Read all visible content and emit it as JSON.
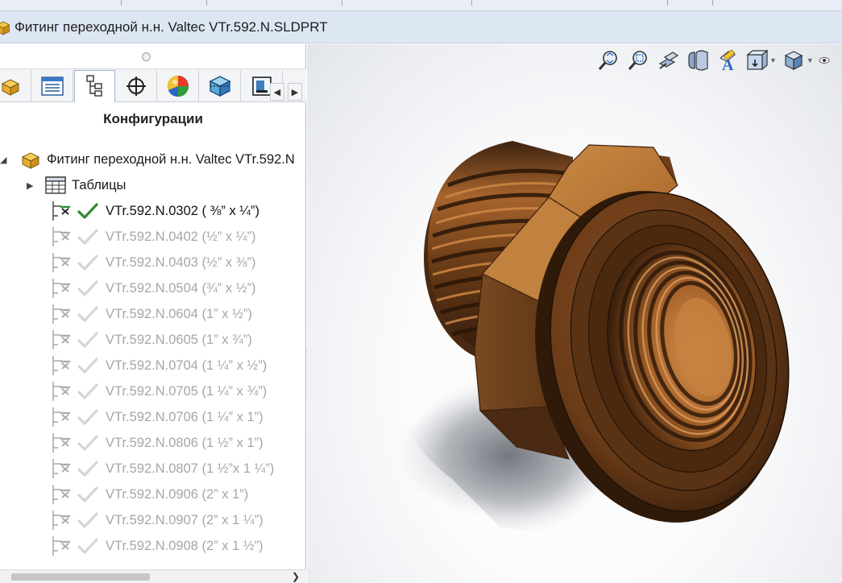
{
  "window": {
    "title": "Фитинг переходной н.н. Valtec VTr.592.N.SLDPRT"
  },
  "left_panel": {
    "heading": "Конфигурации",
    "tabs": [
      {
        "name": "featuremanager",
        "icon": "part-icon"
      },
      {
        "name": "propertymanager",
        "icon": "property-list-icon"
      },
      {
        "name": "configurationmanager",
        "icon": "configuration-icon",
        "active": true
      },
      {
        "name": "dimxpert",
        "icon": "crosshair-icon"
      },
      {
        "name": "displaymanager",
        "icon": "appearance-sphere-icon"
      },
      {
        "name": "cam",
        "icon": "box-view-icon"
      },
      {
        "name": "simulation",
        "icon": "simulation-icon"
      }
    ],
    "tree": {
      "root_label": "Фитинг переходной н.н. Valtec VTr.592.N",
      "tables_label": "Таблицы",
      "configurations": [
        {
          "label": "VTr.592.N.0302 ( ⅜” x ¼”)",
          "active": true
        },
        {
          "label": "VTr.592.N.0402 (½” x ¼”)",
          "active": false
        },
        {
          "label": "VTr.592.N.0403 (½” x  ⅜”)",
          "active": false
        },
        {
          "label": "VTr.592.N.0504 (¾” x ½”)",
          "active": false
        },
        {
          "label": "VTr.592.N.0604 (1” x ½”)",
          "active": false
        },
        {
          "label": "VTr.592.N.0605 (1” x ¾”)",
          "active": false
        },
        {
          "label": "VTr.592.N.0704 (1 ¼” x ½”)",
          "active": false
        },
        {
          "label": "VTr.592.N.0705 (1 ¼” x ¾”)",
          "active": false
        },
        {
          "label": "VTr.592.N.0706 (1 ¼” x 1”)",
          "active": false
        },
        {
          "label": "VTr.592.N.0806 (1 ½” x 1”)",
          "active": false
        },
        {
          "label": "VTr.592.N.0807 (1 ½”x 1 ¼”)",
          "active": false
        },
        {
          "label": "VTr.592.N.0906 (2” x 1”)",
          "active": false
        },
        {
          "label": "VTr.592.N.0907 (2” x 1 ¼”)",
          "active": false
        },
        {
          "label": "VTr.592.N.0908 (2” x 1 ½”)",
          "active": false
        }
      ]
    }
  },
  "heads_up_toolbar": [
    {
      "name": "zoom-to-fit-icon"
    },
    {
      "name": "zoom-to-area-icon"
    },
    {
      "name": "previous-view-icon"
    },
    {
      "name": "section-view-icon"
    },
    {
      "name": "dynamic-annotation-icon"
    },
    {
      "name": "view-orientation-icon",
      "dropdown": true
    },
    {
      "name": "display-style-icon",
      "dropdown": true
    }
  ],
  "colors": {
    "accent": "#2e8b2e",
    "brass_light": "#c07a3a",
    "brass_mid": "#8a4f1f",
    "brass_dark": "#3e2210",
    "inactive_text": "#a3a6ab"
  }
}
